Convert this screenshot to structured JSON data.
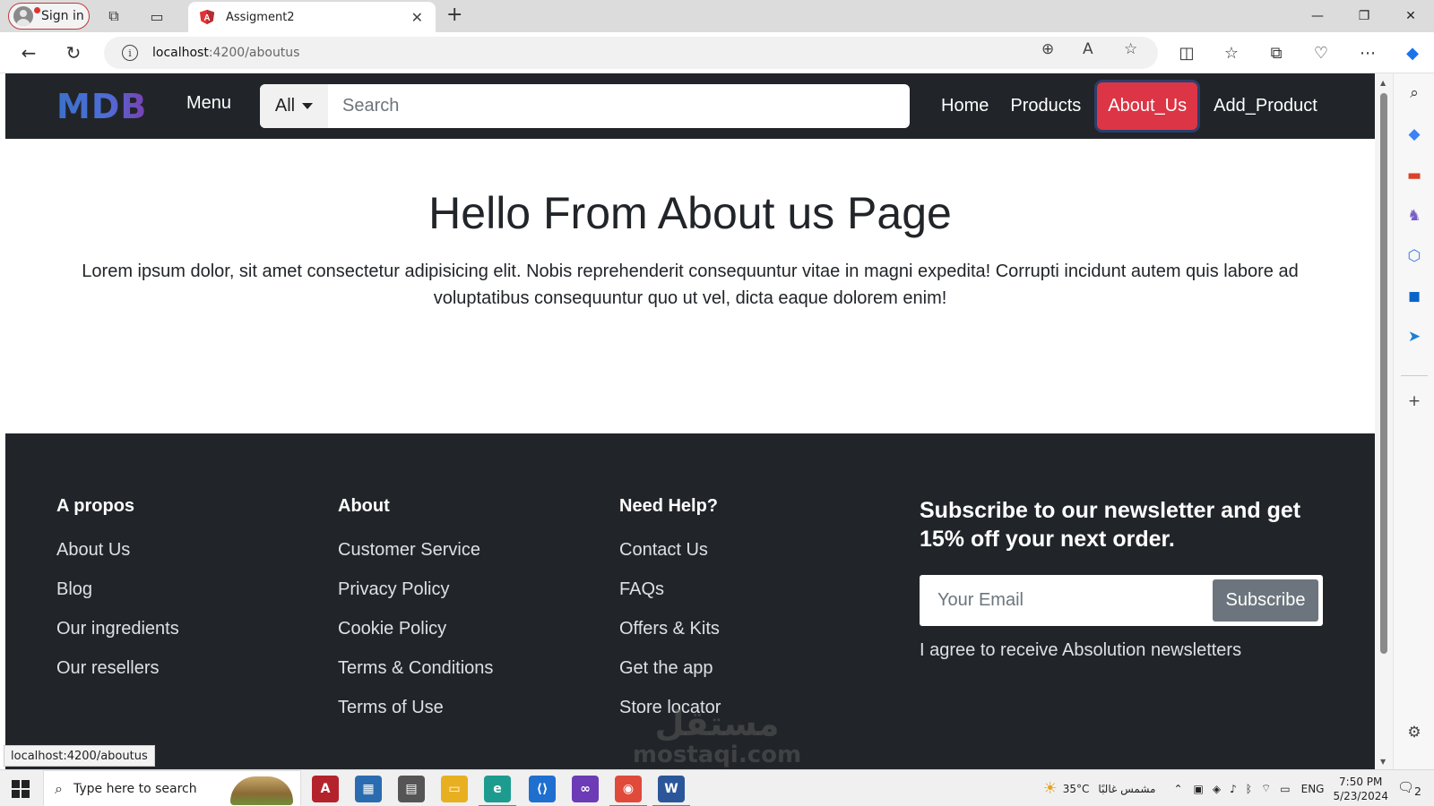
{
  "browser": {
    "signin_label": "Sign in",
    "tab_title": "Assigment2",
    "url_host": "localhost",
    "url_path": ":4200/aboutus",
    "status_url": "localhost:4200/aboutus"
  },
  "navbar": {
    "brand": "MDB",
    "menu_label": "Menu",
    "search_category": "All",
    "search_placeholder": "Search",
    "links": [
      {
        "label": "Home",
        "active": false
      },
      {
        "label": "Products",
        "active": false
      },
      {
        "label": "About_Us",
        "active": true
      },
      {
        "label": "Add_Product",
        "active": false
      }
    ]
  },
  "content": {
    "title": "Hello From About us Page",
    "body": "Lorem ipsum dolor, sit amet consectetur adipisicing elit. Nobis reprehenderit consequuntur vitae in magni expedita! Corrupti incidunt autem quis labore ad voluptatibus consequuntur quo ut vel, dicta eaque dolorem enim!"
  },
  "footer": {
    "columns": [
      {
        "heading": "A propos",
        "links": [
          "About Us",
          "Blog",
          "Our ingredients",
          "Our resellers"
        ]
      },
      {
        "heading": "About",
        "links": [
          "Customer Service",
          "Privacy Policy",
          "Cookie Policy",
          "Terms & Conditions",
          "Terms of Use"
        ]
      },
      {
        "heading": "Need Help?",
        "links": [
          "Contact Us",
          "FAQs",
          "Offers & Kits",
          "Get the app",
          "Store locator"
        ]
      }
    ],
    "newsletter": {
      "heading": "Subscribe to our newsletter and get 15% off your next order.",
      "email_placeholder": "Your Email",
      "button_label": "Subscribe",
      "agree_text": "I agree to receive Absolution newsletters"
    }
  },
  "watermark": {
    "arabic": "مستقل",
    "latin": "mostaqi.com"
  },
  "taskbar": {
    "search_placeholder": "Type here to search",
    "weather_temp": "35°C",
    "weather_desc": "مشمس غالبًا",
    "lang": "ENG",
    "time": "7:50 PM",
    "date": "5/23/2024",
    "notifications": "2"
  },
  "colors": {
    "navbar_bg": "#212529",
    "active_link": "#dc3545",
    "subscribe_btn": "#6c757d"
  }
}
